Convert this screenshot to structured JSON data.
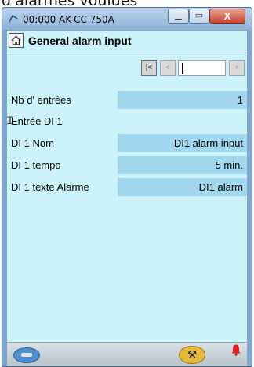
{
  "page_caption": "d'alarmes voulues",
  "window": {
    "title": "00:000 AK-CC 750A",
    "min_glyph": "▁",
    "max_glyph": "▭",
    "close_glyph": "X"
  },
  "header": {
    "title": "General alarm input",
    "home_icon": "home-icon"
  },
  "nav": {
    "first_glyph": "|<",
    "prev_glyph": "<",
    "field_value": "",
    "next_glyph": "+"
  },
  "rows": [
    {
      "label": "Nb d' entrées",
      "value": "1"
    },
    {
      "label": "Entrée DI 1",
      "value": ""
    },
    {
      "label": "DI 1 Nom",
      "value": "DI1 alarm input"
    },
    {
      "label": "DI 1 tempo",
      "value": "5 min."
    },
    {
      "label": "DI 1 texte Alarme",
      "value": "DI1 alarm"
    }
  ],
  "footer": {
    "left_icon": "link-icon",
    "mid_icon": "wrench-icon",
    "alarm_icon": "alarm-bell-icon"
  },
  "colors": {
    "client_bg": "#ccf2fa",
    "value_bg": "#a2d8ed",
    "window_frame": "#7fa8cf"
  }
}
